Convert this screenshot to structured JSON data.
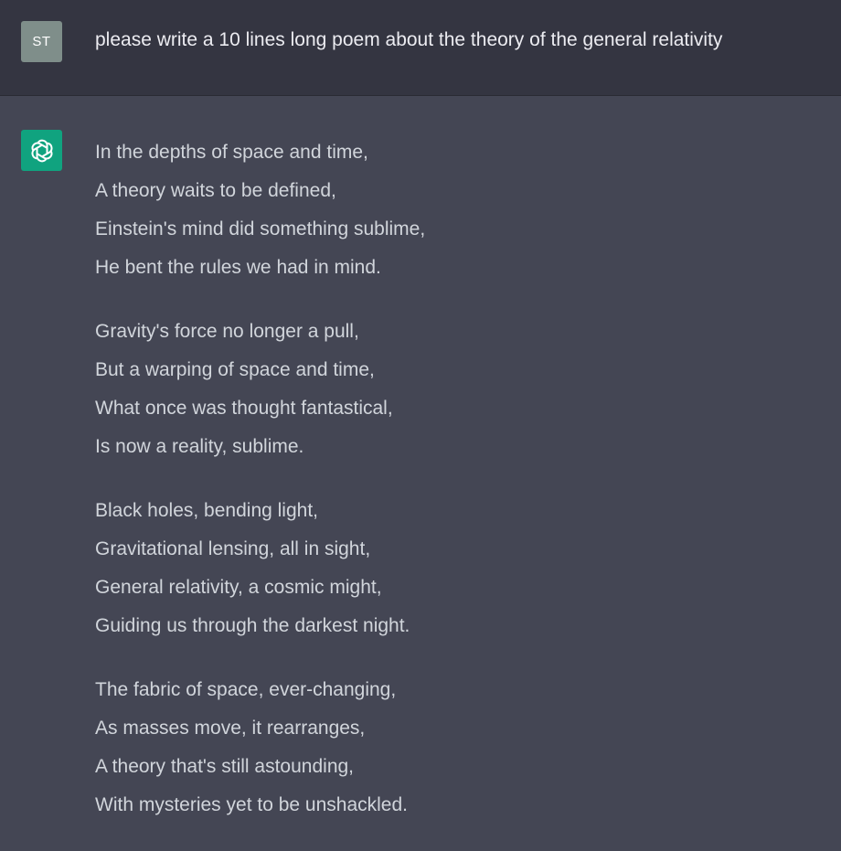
{
  "user": {
    "initials": "ST",
    "message": "please write a 10 lines long poem about the theory of the general relativity"
  },
  "assistant": {
    "icon": "openai-logo-icon",
    "accent": "#10a37f",
    "stanzas": [
      [
        "In the depths of space and time,",
        "A theory waits to be defined,",
        "Einstein's mind did something sublime,",
        "He bent the rules we had in mind."
      ],
      [
        "Gravity's force no longer a pull,",
        "But a warping of space and time,",
        "What once was thought fantastical,",
        "Is now a reality, sublime."
      ],
      [
        "Black holes, bending light,",
        "Gravitational lensing, all in sight,",
        "General relativity, a cosmic might,",
        "Guiding us through the darkest night."
      ],
      [
        "The fabric of space, ever-changing,",
        "As masses move, it rearranges,",
        "A theory that's still astounding,",
        "With mysteries yet to be unshackled."
      ]
    ]
  }
}
